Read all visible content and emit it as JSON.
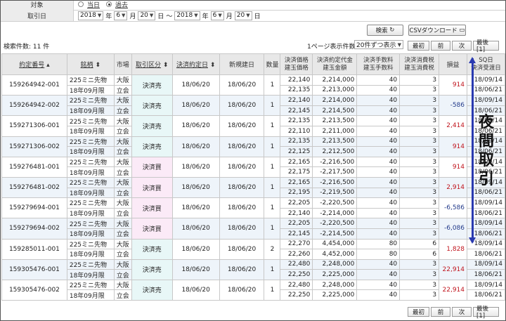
{
  "filters": {
    "target_label": "対象",
    "radio_today": "当日",
    "radio_past": "過去",
    "date_label": "取引日",
    "from": {
      "year": "2018",
      "month": "6",
      "day": "20"
    },
    "to": {
      "year": "2018",
      "month": "6",
      "day": "20"
    },
    "year_unit": "年",
    "month_unit": "月",
    "day_unit": "日",
    "tilde": "～"
  },
  "toolbar": {
    "search_label": "検索",
    "csv_label": "CSVダウンロード",
    "count_label": "検索件数: 11 件",
    "perpage_label": "1ページ表示件数",
    "perpage_value": "20件ずつ表示"
  },
  "pager": {
    "first": "最初",
    "prev": "前",
    "next": "次",
    "last": "最後[1]"
  },
  "headers": {
    "order_no": "約定番号",
    "name": "銘柄",
    "market": "市場",
    "kubun": "取引区分",
    "settle_date": "決済約定日",
    "new_date": "新規建日",
    "qty": "数量",
    "price_top": "決済価格",
    "price_bottom": "建玉価格",
    "amount_top": "決済約定代金",
    "amount_bottom": "建玉金額",
    "fee_top": "決済手数料",
    "fee_bottom": "建玉手数料",
    "tax_top": "決済消費税",
    "tax_bottom": "建玉消費税",
    "pl": "損益",
    "sq_top": "SQ日",
    "sq_bottom": "決済受渡日"
  },
  "rows": [
    {
      "order_no": "159264942-001",
      "name1": "225ミニ先物",
      "name2": "18年09月限",
      "market1": "大阪",
      "market2": "立会",
      "kubun": "決済売",
      "settle_date": "18/06/20",
      "new_date": "18/06/20",
      "qty": "1",
      "price1": "22,140",
      "price2": "22,135",
      "amount1": "2,214,000",
      "amount2": "2,213,000",
      "fee1": "40",
      "fee2": "40",
      "tax1": "3",
      "tax2": "3",
      "pl": "914",
      "sq1": "18/09/14",
      "sq2": "18/06/21"
    },
    {
      "order_no": "159264942-002",
      "name1": "225ミニ先物",
      "name2": "18年09月限",
      "market1": "大阪",
      "market2": "立会",
      "kubun": "決済売",
      "settle_date": "18/06/20",
      "new_date": "18/06/20",
      "qty": "1",
      "price1": "22,140",
      "price2": "22,145",
      "amount1": "2,214,000",
      "amount2": "2,214,500",
      "fee1": "40",
      "fee2": "40",
      "tax1": "3",
      "tax2": "3",
      "pl": "-586",
      "sq1": "18/09/14",
      "sq2": "18/06/21"
    },
    {
      "order_no": "159271306-001",
      "name1": "225ミニ先物",
      "name2": "18年09月限",
      "market1": "大阪",
      "market2": "立会",
      "kubun": "決済売",
      "settle_date": "18/06/20",
      "new_date": "18/06/20",
      "qty": "1",
      "price1": "22,135",
      "price2": "22,110",
      "amount1": "2,213,500",
      "amount2": "2,211,000",
      "fee1": "40",
      "fee2": "40",
      "tax1": "3",
      "tax2": "3",
      "pl": "2,414",
      "sq1": "18/09/14",
      "sq2": "18/06/21"
    },
    {
      "order_no": "159271306-002",
      "name1": "225ミニ先物",
      "name2": "18年09月限",
      "market1": "大阪",
      "market2": "立会",
      "kubun": "決済売",
      "settle_date": "18/06/20",
      "new_date": "18/06/20",
      "qty": "1",
      "price1": "22,135",
      "price2": "22,125",
      "amount1": "2,213,500",
      "amount2": "2,212,500",
      "fee1": "40",
      "fee2": "40",
      "tax1": "3",
      "tax2": "3",
      "pl": "914",
      "sq1": "18/09/14",
      "sq2": "18/06/21"
    },
    {
      "order_no": "159276481-001",
      "name1": "225ミニ先物",
      "name2": "18年09月限",
      "market1": "大阪",
      "market2": "立会",
      "kubun": "決済買",
      "settle_date": "18/06/20",
      "new_date": "18/06/20",
      "qty": "1",
      "price1": "22,165",
      "price2": "22,175",
      "amount1": "-2,216,500",
      "amount2": "-2,217,500",
      "fee1": "40",
      "fee2": "40",
      "tax1": "3",
      "tax2": "3",
      "pl": "914",
      "sq1": "18/09/14",
      "sq2": "18/06/21"
    },
    {
      "order_no": "159276481-002",
      "name1": "225ミニ先物",
      "name2": "18年09月限",
      "market1": "大阪",
      "market2": "立会",
      "kubun": "決済買",
      "settle_date": "18/06/20",
      "new_date": "18/06/20",
      "qty": "1",
      "price1": "22,165",
      "price2": "22,195",
      "amount1": "-2,216,500",
      "amount2": "-2,219,500",
      "fee1": "40",
      "fee2": "40",
      "tax1": "3",
      "tax2": "3",
      "pl": "2,914",
      "sq1": "18/09/14",
      "sq2": "18/06/21"
    },
    {
      "order_no": "159279694-001",
      "name1": "225ミニ先物",
      "name2": "18年09月限",
      "market1": "大阪",
      "market2": "立会",
      "kubun": "決済買",
      "settle_date": "18/06/20",
      "new_date": "18/06/20",
      "qty": "1",
      "price1": "22,205",
      "price2": "22,140",
      "amount1": "-2,220,500",
      "amount2": "-2,214,000",
      "fee1": "40",
      "fee2": "40",
      "tax1": "3",
      "tax2": "3",
      "pl": "-6,586",
      "sq1": "18/09/14",
      "sq2": "18/06/21"
    },
    {
      "order_no": "159279694-002",
      "name1": "225ミニ先物",
      "name2": "18年09月限",
      "market1": "大阪",
      "market2": "立会",
      "kubun": "決済買",
      "settle_date": "18/06/20",
      "new_date": "18/06/20",
      "qty": "1",
      "price1": "22,205",
      "price2": "22,145",
      "amount1": "-2,220,500",
      "amount2": "-2,214,500",
      "fee1": "40",
      "fee2": "40",
      "tax1": "3",
      "tax2": "3",
      "pl": "-6,086",
      "sq1": "18/09/14",
      "sq2": "18/06/21"
    },
    {
      "order_no": "159285011-001",
      "name1": "225ミニ先物",
      "name2": "18年09月限",
      "market1": "大阪",
      "market2": "立会",
      "kubun": "決済売",
      "settle_date": "18/06/20",
      "new_date": "18/06/20",
      "qty": "2",
      "price1": "22,270",
      "price2": "22,260",
      "amount1": "4,454,000",
      "amount2": "4,452,000",
      "fee1": "80",
      "fee2": "80",
      "tax1": "6",
      "tax2": "6",
      "pl": "1,828",
      "sq1": "18/09/14",
      "sq2": "18/06/21"
    },
    {
      "order_no": "159305476-001",
      "name1": "225ミニ先物",
      "name2": "18年09月限",
      "market1": "大阪",
      "market2": "立会",
      "kubun": "決済売",
      "settle_date": "18/06/20",
      "new_date": "18/06/20",
      "qty": "1",
      "price1": "22,480",
      "price2": "22,250",
      "amount1": "2,248,000",
      "amount2": "2,225,000",
      "fee1": "40",
      "fee2": "40",
      "tax1": "3",
      "tax2": "3",
      "pl": "22,914",
      "sq1": "18/09/14",
      "sq2": "18/06/21"
    },
    {
      "order_no": "159305476-002",
      "name1": "225ミニ先物",
      "name2": "18年09月限",
      "market1": "大阪",
      "market2": "立会",
      "kubun": "決済売",
      "settle_date": "18/06/20",
      "new_date": "18/06/20",
      "qty": "1",
      "price1": "22,480",
      "price2": "22,250",
      "amount1": "2,248,000",
      "amount2": "2,225,000",
      "fee1": "40",
      "fee2": "40",
      "tax1": "3",
      "tax2": "3",
      "pl": "22,914",
      "sq1": "18/09/14",
      "sq2": "18/06/21"
    }
  ],
  "annotation": {
    "chars": [
      "夜",
      "間",
      "取",
      "引"
    ],
    "color": "#2a3ab0"
  },
  "colors": {
    "profit": "#c0141d",
    "loss": "#223a8a",
    "sell_bg": "#e8f7f7",
    "buy_bg": "#fbeaf7"
  }
}
